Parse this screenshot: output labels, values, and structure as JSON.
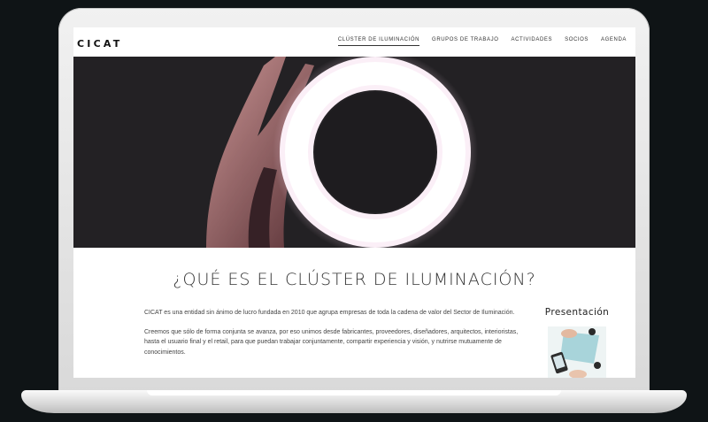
{
  "brand": {
    "logo": "CICAT"
  },
  "nav": {
    "items": [
      {
        "label": "CLÚSTER DE ILUMINACIÓN",
        "active": true
      },
      {
        "label": "GRUPOS DE TRABAJO",
        "active": false
      },
      {
        "label": "ACTIVIDADES",
        "active": false
      },
      {
        "label": "SOCIOS",
        "active": false
      },
      {
        "label": "AGENDA",
        "active": false
      }
    ]
  },
  "main": {
    "title": "¿QUÉ ES EL CLÚSTER DE ILUMINACIÓN?",
    "paragraphs": [
      "CICAT es una entidad sin ánimo de lucro fundada en 2010 que agrupa empresas de toda la cadena de valor del Sector de Iluminación.",
      "Creemos que sólo de forma conjunta se avanza, por eso unimos desde fabricantes, proveedores, diseñadores, arquitectos, interioristas, hasta el usuario final y el retail, para que puedan trabajar conjuntamente, compartir experiencia y visión, y nutrirse mutuamente de conocimientos."
    ]
  },
  "aside": {
    "title": "Presentación"
  },
  "colors": {
    "background": "#0f1416",
    "hero": "#232124",
    "ring": "#ffffff",
    "text": "#333333"
  }
}
